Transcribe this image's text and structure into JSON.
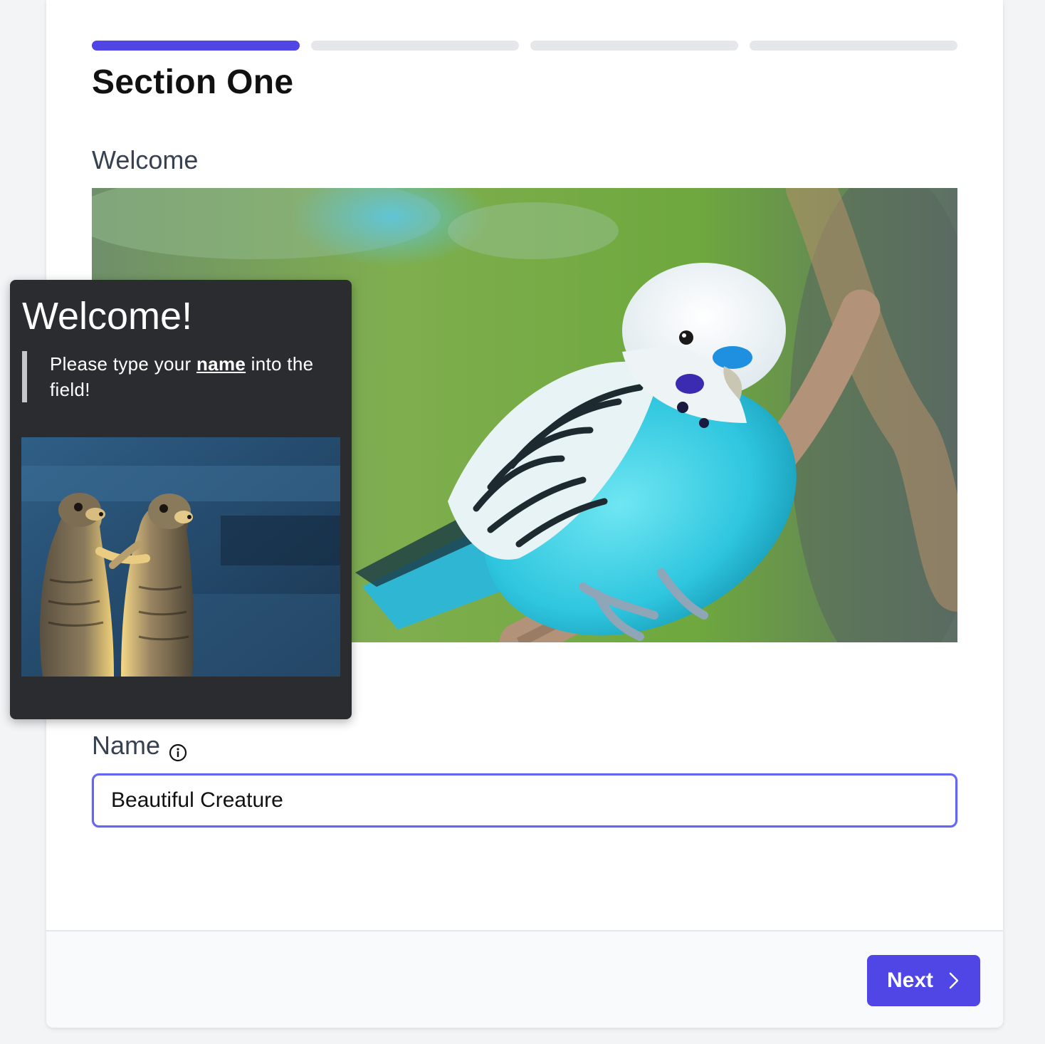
{
  "progress": {
    "steps": 4,
    "current_step": 1,
    "active_color": "#4f46e5",
    "inactive_color": "#e5e7eb"
  },
  "section": {
    "title": "Section One"
  },
  "welcome_field": {
    "title": "Welcome",
    "image_subject": "blue budgerigar perched on a branch"
  },
  "name_field": {
    "label": "Name",
    "value": "Beautiful Creature",
    "info_icon": "info-circle-icon"
  },
  "footer": {
    "next_label": "Next",
    "next_icon": "chevron-right-icon",
    "button_color": "#4f46e5"
  },
  "tooltip": {
    "title": "Welcome!",
    "text_before": "Please type your ",
    "text_emphasis": "name",
    "text_after": " into the field!",
    "image_subject": "two meerkats standing"
  }
}
